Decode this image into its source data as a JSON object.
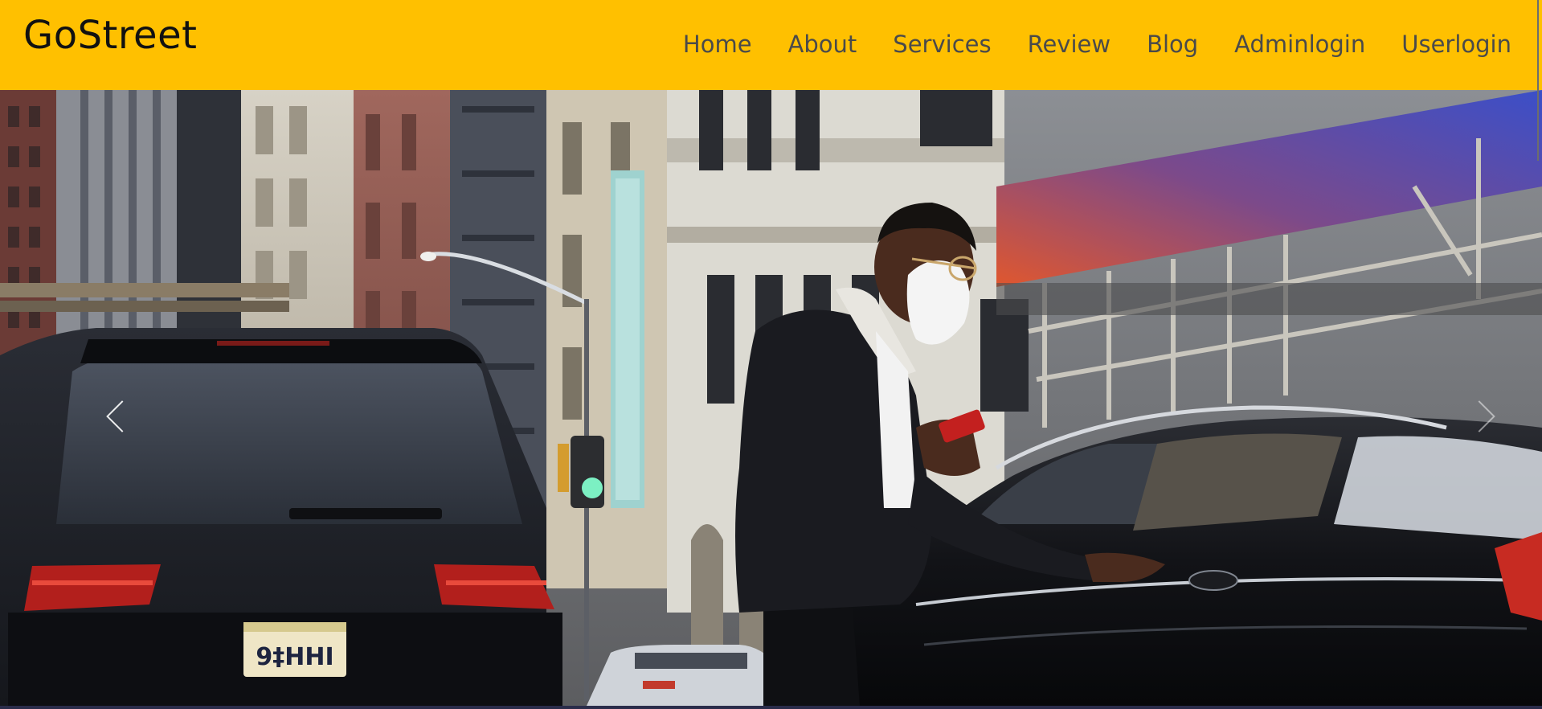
{
  "site": {
    "brand": "GoStreet"
  },
  "nav": {
    "items": [
      {
        "label": "Home"
      },
      {
        "label": "About"
      },
      {
        "label": "Services"
      },
      {
        "label": "Review"
      },
      {
        "label": "Blog"
      },
      {
        "label": "Adminlogin"
      },
      {
        "label": "Userlogin"
      }
    ]
  },
  "hero": {
    "plate_text": "9‡HHI",
    "prev_icon": "chevron-left-icon",
    "next_icon": "chevron-right-icon"
  },
  "colors": {
    "header_bg": "#ffc000",
    "brand_text": "#111111",
    "nav_text": "#4a4a4a"
  }
}
